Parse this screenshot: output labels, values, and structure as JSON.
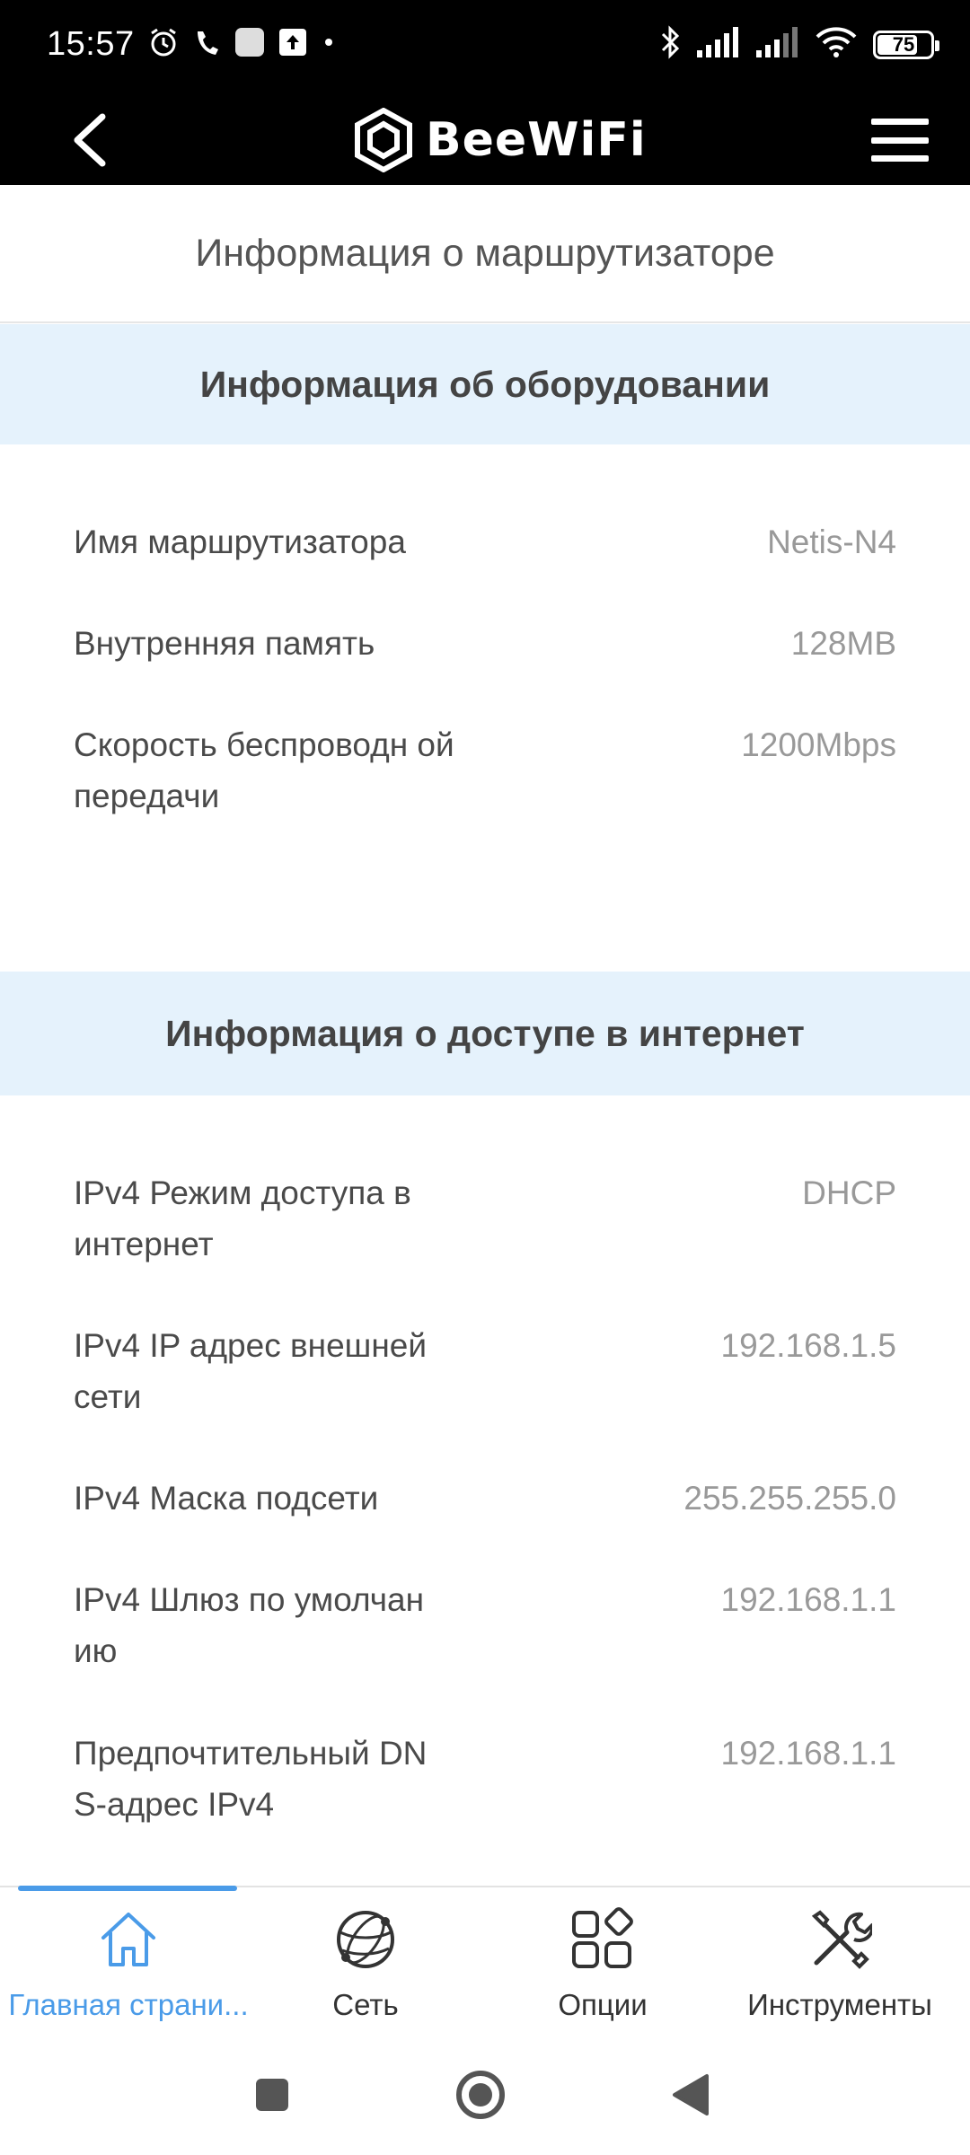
{
  "status_bar": {
    "time": "15:57",
    "battery": "75",
    "battery_level": 0.75
  },
  "app_bar": {
    "logo_text": "BeeWiFi"
  },
  "page": {
    "title": "Информация о маршрутизаторе"
  },
  "hardware": {
    "title": "Информация об оборудовании",
    "rows": [
      {
        "label": "Имя маршрутизатора",
        "value": "Netis-N4"
      },
      {
        "label": "Внутренняя память",
        "value": "128MB"
      },
      {
        "label": "Скорость беспроводн ой передачи",
        "value": "1200Mbps"
      }
    ]
  },
  "internet": {
    "title": "Информация о доступе в интернет",
    "rows": [
      {
        "label": "IPv4 Режим доступа в интернет",
        "value": "DHCP"
      },
      {
        "label": "IPv4 IP адрес внешней сети",
        "value": "192.168.1.5"
      },
      {
        "label": "IPv4 Маска подсети",
        "value": "255.255.255.0"
      },
      {
        "label": "IPv4 Шлюз по умолчан ию",
        "value": "192.168.1.1"
      },
      {
        "label": "Предпочтительный DN S-адрес IPv4",
        "value": "192.168.1.1"
      }
    ]
  },
  "bottom_nav": {
    "items": [
      {
        "label": "Главная страни...",
        "icon": "home-icon",
        "active": true
      },
      {
        "label": "Сеть",
        "icon": "network-globe-icon",
        "active": false
      },
      {
        "label": "Опции",
        "icon": "options-grid-icon",
        "active": false
      },
      {
        "label": "Инструменты",
        "icon": "tools-icon",
        "active": false
      }
    ]
  },
  "colors": {
    "accent": "#4a9be8",
    "section_bg": "#e5f2fc",
    "header_bg": "#000000"
  }
}
